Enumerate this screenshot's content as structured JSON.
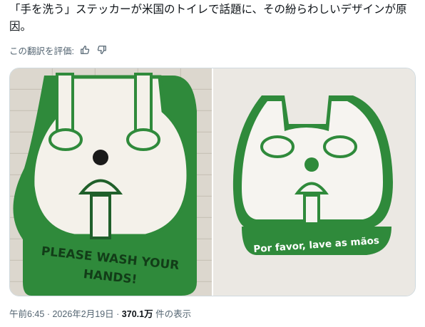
{
  "post": {
    "text": "「手を洗う」ステッカーが米国のトイレで話題に、その紛らわしいデザインが原因。"
  },
  "translation": {
    "label": "この翻訳を評価:",
    "like_icon": "thumbs-up-icon",
    "dislike_icon": "thumbs-down-icon"
  },
  "media": {
    "left_sticker_text": [
      "PLEASE WASH YOUR",
      "HANDS!"
    ],
    "right_sticker_text": "Por favor, lave as mãos",
    "sticker_color": "#2f8a3b"
  },
  "meta": {
    "time": "午前6:45",
    "separator": "·",
    "date": "2026年2月19日",
    "views_count": "370.1万",
    "views_label": "件の表示"
  }
}
